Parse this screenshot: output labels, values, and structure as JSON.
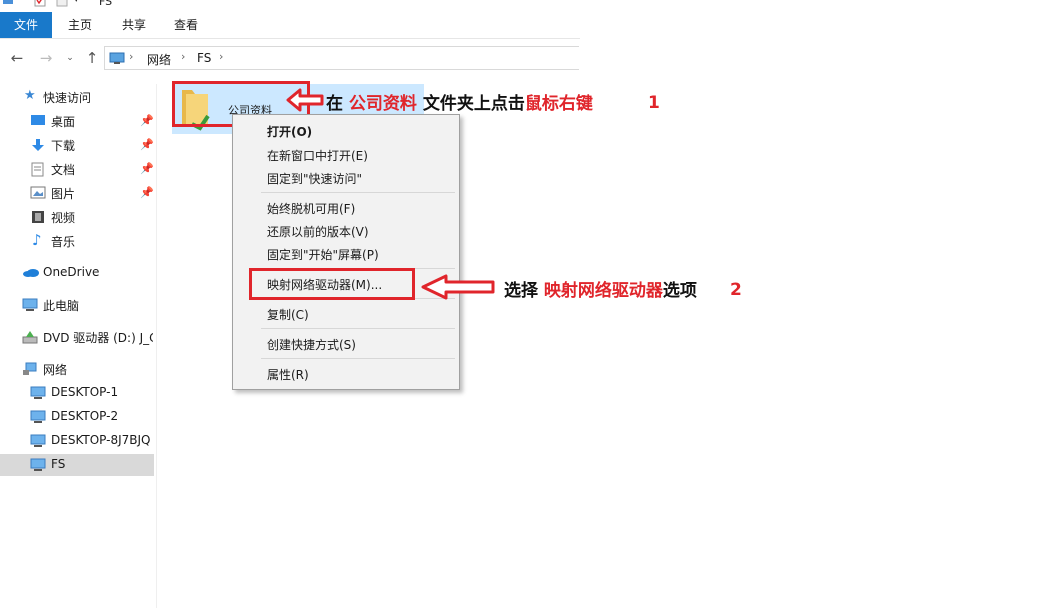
{
  "window": {
    "title": "FS"
  },
  "ribbon": {
    "tabs": [
      "文件",
      "主页",
      "共享",
      "查看"
    ]
  },
  "address": {
    "crumbs": [
      "网络",
      "FS"
    ],
    "separator": "›"
  },
  "nav": {
    "quick_access": "快速访问",
    "quick_items": [
      "桌面",
      "下载",
      "文档",
      "图片",
      "视频",
      "音乐"
    ],
    "pin_glyph": "📌",
    "onedrive": "OneDrive",
    "this_pc": "此电脑",
    "dvd": "DVD 驱动器 (D:) J_C",
    "network": "网络",
    "network_items": [
      "DESKTOP-1",
      "DESKTOP-2",
      "DESKTOP-8J7BJQ",
      "FS"
    ]
  },
  "folder": {
    "name": "公司资料"
  },
  "menu": {
    "items": [
      "打开(O)",
      "在新窗口中打开(E)",
      "固定到\"快速访问\"",
      "始终脱机可用(F)",
      "还原以前的版本(V)",
      "固定到\"开始\"屏幕(P)",
      "映射网络驱动器(M)...",
      "复制(C)",
      "创建快捷方式(S)",
      "属性(R)"
    ]
  },
  "annotations": {
    "step1": {
      "prefix": "在 ",
      "highlight1": "公司资料",
      "middle": " 文件夹上点击",
      "highlight2": "鼠标右键",
      "number": "1"
    },
    "step2": {
      "prefix": "选择 ",
      "highlight": "映射网络驱动器",
      "suffix": "选项",
      "number": "2"
    }
  },
  "colors": {
    "accent": "#1979ca",
    "annotation_red": "#e0252b",
    "selection": "#cce8ff"
  }
}
